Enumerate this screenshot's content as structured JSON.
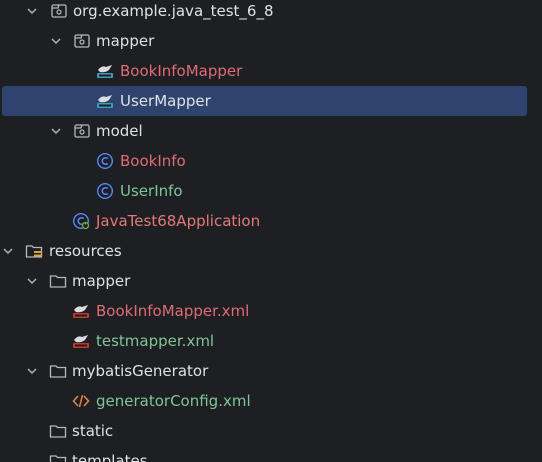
{
  "colors": {
    "default_text": "#dfe1e5",
    "modified_text": "#e06c75",
    "added_text": "#7ec699",
    "selection_bg": "#2e436e",
    "background": "#1e1f22"
  },
  "tree": {
    "package_root": {
      "label": "org.example.java_test_6_8",
      "icon": "package-icon"
    },
    "mapper_pkg": {
      "label": "mapper",
      "icon": "package-icon"
    },
    "book_info_mapper": {
      "label": "BookInfoMapper",
      "icon": "mybatis-mapper-icon"
    },
    "user_mapper": {
      "label": "UserMapper",
      "icon": "mybatis-mapper-icon"
    },
    "model_pkg": {
      "label": "model",
      "icon": "package-icon"
    },
    "book_info": {
      "label": "BookInfo",
      "icon": "class-icon"
    },
    "user_info": {
      "label": "UserInfo",
      "icon": "class-icon"
    },
    "application": {
      "label": "JavaTest68Application",
      "icon": "spring-boot-class-icon"
    },
    "resources": {
      "label": "resources",
      "icon": "resources-folder-icon"
    },
    "res_mapper": {
      "label": "mapper",
      "icon": "folder-icon"
    },
    "book_info_mapper_xml": {
      "label": "BookInfoMapper.xml",
      "icon": "mybatis-xml-icon"
    },
    "testmapper_xml": {
      "label": "testmapper.xml",
      "icon": "mybatis-xml-icon"
    },
    "mybatis_generator": {
      "label": "mybatisGenerator",
      "icon": "folder-icon"
    },
    "generator_config": {
      "label": "generatorConfig.xml",
      "icon": "xml-icon"
    },
    "static_dir": {
      "label": "static",
      "icon": "folder-icon"
    },
    "templates_dir": {
      "label": "templates",
      "icon": "folder-icon"
    }
  }
}
